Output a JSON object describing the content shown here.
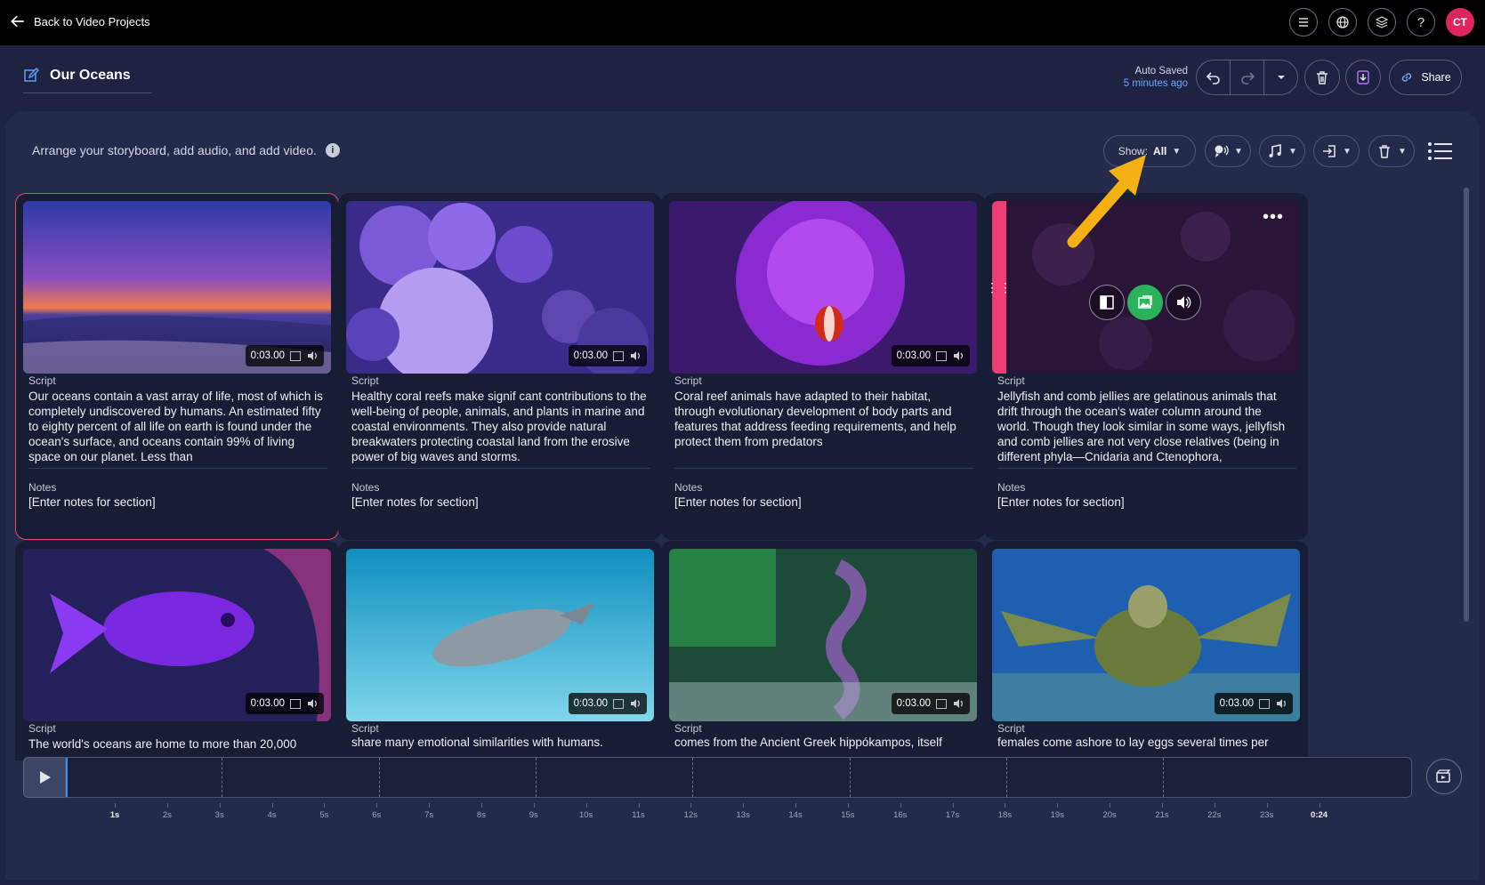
{
  "topbar": {
    "back_label": "Back to Video Projects",
    "icons": [
      "menu-icon",
      "globe-icon",
      "layers-icon",
      "help-icon"
    ],
    "avatar_initials": "CT",
    "avatar_color": "#e0245e"
  },
  "project": {
    "title": "Our Oceans",
    "autosave_line1": "Auto Saved",
    "autosave_line2": "5 minutes ago",
    "share_label": "Share"
  },
  "storyboard": {
    "instruction": "Arrange your storyboard, add audio, and add video.",
    "show_label": "Show:",
    "show_value": "All"
  },
  "cards": [
    {
      "duration": "0:03.00",
      "script_label": "Script",
      "script": "Our oceans contain a vast array of life, most of which is completely undiscovered by humans.  An estimated fifty to eighty percent of all life on earth is found under the ocean's surface, and oceans contain 99% of living space on our planet. Less than",
      "notes_label": "Notes",
      "notes": "[Enter notes for section]"
    },
    {
      "duration": "0:03.00",
      "script_label": "Script",
      "script": "Healthy coral reefs make signif cant contributions to the well-being of people, animals, and plants in marine and coastal environments. They also provide natural breakwaters protecting coastal land from the erosive power of big waves and storms.",
      "notes_label": "Notes",
      "notes": "[Enter notes for section]"
    },
    {
      "duration": "0:03.00",
      "script_label": "Script",
      "script": "Coral reef animals have adapted to their habitat, through evolutionary development of body parts and features that address feeding requirements, and help protect them from predators",
      "notes_label": "Notes",
      "notes": "[Enter notes for section]"
    },
    {
      "duration": "",
      "script_label": "Script",
      "script": "Jellyfish and comb jellies are gelatinous animals that drift through the ocean's water column around the world.  Though they look similar in some ways, jellyfish and comb jellies are not very close relatives (being in different phyla—Cnidaria and Ctenophora,",
      "notes_label": "Notes",
      "notes": "[Enter notes for section]"
    },
    {
      "duration": "0:03.00",
      "script_label": "Script",
      "script": "The world's oceans are home to more than 20,000",
      "notes_label": "",
      "notes": ""
    },
    {
      "duration": "0:03.00",
      "script_label": "Script",
      "script": "share many emotional similarities with humans.",
      "notes_label": "",
      "notes": ""
    },
    {
      "duration": "0:03.00",
      "script_label": "Script",
      "script": "comes from the Ancient Greek hippókampos, itself",
      "notes_label": "",
      "notes": ""
    },
    {
      "duration": "0:03.00",
      "script_label": "Script",
      "script": "females come ashore to lay eggs several times per",
      "notes_label": "",
      "notes": ""
    }
  ],
  "timeline": {
    "ticks": [
      "1s",
      "2s",
      "3s",
      "4s",
      "5s",
      "6s",
      "7s",
      "8s",
      "9s",
      "10s",
      "11s",
      "12s",
      "13s",
      "14s",
      "15s",
      "16s",
      "17s",
      "18s",
      "19s",
      "20s",
      "21s",
      "22s",
      "23s",
      "0:24"
    ]
  },
  "colors": {
    "accent_blue": "#6fa6ff",
    "selected_border": "#e54a6b",
    "drag_handle": "#ef3d73",
    "image_button": "#2bb35b",
    "annotation_arrow": "#f5b014"
  }
}
